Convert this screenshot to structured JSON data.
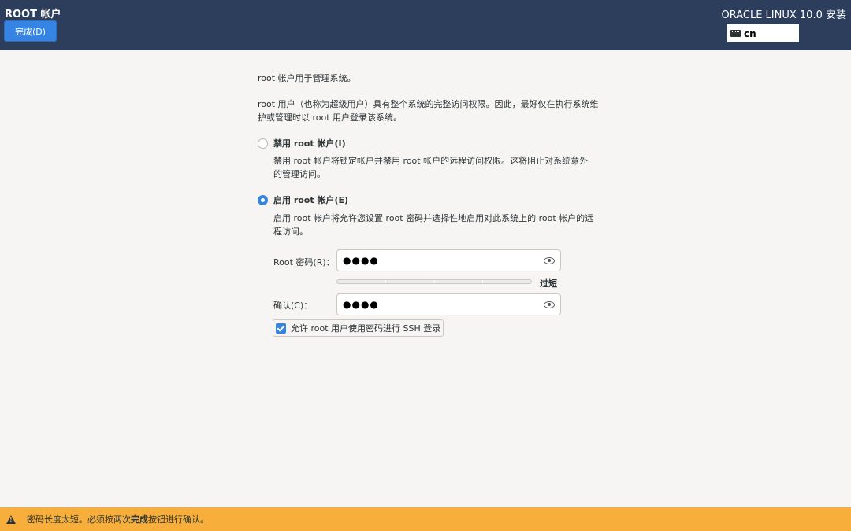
{
  "header": {
    "title": "ROOT 帐户",
    "done_label": "完成(D)",
    "product": "ORACLE LINUX 10.0 安装",
    "keyboard_layout": "cn"
  },
  "intro": {
    "line1": "root 帐户用于管理系统。",
    "line2": "root 用户（也称为超级用户）具有整个系统的完整访问权限。因此，最好仅在执行系统维护或管理时以 root 用户登录该系统。"
  },
  "options": {
    "disable": {
      "label": "禁用 root 帐户(I)",
      "description": "禁用 root 帐户将锁定帐户并禁用 root 帐户的远程访问权限。这将阻止对系统意外的管理访问。",
      "checked": false
    },
    "enable": {
      "label": "启用 root 帐户(E)",
      "description": "启用 root 帐户将允许您设置 root 密码并选择性地启用对此系统上的 root 帐户的远程访问。",
      "checked": true
    }
  },
  "password": {
    "label": "Root 密码(R)：",
    "value": "●●●●",
    "strength_label": "过短"
  },
  "confirm": {
    "label": "确认(C)：",
    "value": "●●●●"
  },
  "ssh": {
    "label": "允许 root 用户使用密码进行 SSH 登录",
    "checked": true
  },
  "warning": {
    "prefix": "密码长度太短。必须按两次",
    "emphasis": "完成",
    "suffix": "按钮进行确认。"
  },
  "icons": {
    "keyboard": "keyboard-icon",
    "eye": "eye-icon",
    "warning": "warning-icon"
  },
  "colors": {
    "header_bg": "#2c3e5c",
    "accent": "#3584e4",
    "warning_bg": "#f8ae3a",
    "page_bg": "#f6f5f4"
  }
}
